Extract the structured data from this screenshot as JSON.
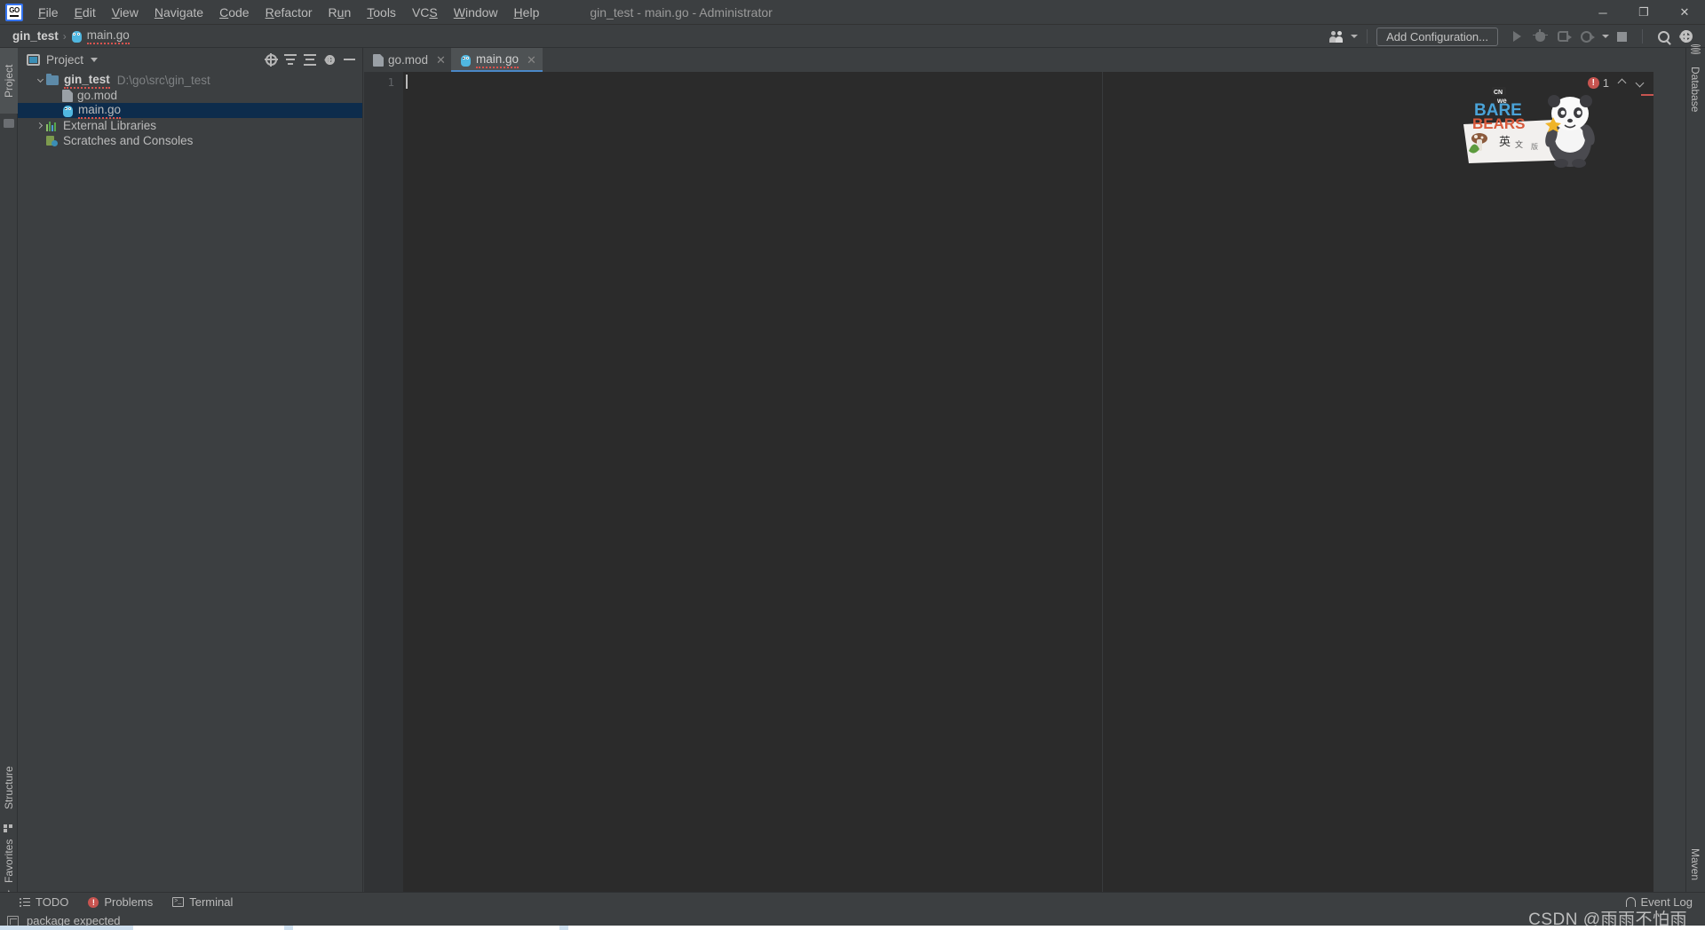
{
  "window": {
    "title": "gin_test - main.go - Administrator",
    "logo_text": "GO",
    "minimize": "─",
    "maximize": "❐",
    "close": "✕"
  },
  "menu": {
    "items": [
      {
        "label": "File",
        "mnemonic": "F"
      },
      {
        "label": "Edit",
        "mnemonic": "E"
      },
      {
        "label": "View",
        "mnemonic": "V"
      },
      {
        "label": "Navigate",
        "mnemonic": "N"
      },
      {
        "label": "Code",
        "mnemonic": "C"
      },
      {
        "label": "Refactor",
        "mnemonic": "R"
      },
      {
        "label": "Run",
        "mnemonic": "u"
      },
      {
        "label": "Tools",
        "mnemonic": "T"
      },
      {
        "label": "VCS",
        "mnemonic": "S"
      },
      {
        "label": "Window",
        "mnemonic": "W"
      },
      {
        "label": "Help",
        "mnemonic": "H"
      }
    ]
  },
  "breadcrumb": {
    "project": "gin_test",
    "separator": "›",
    "file": "main.go"
  },
  "toolbar": {
    "add_configuration": "Add Configuration...",
    "run_tooltip": "Run",
    "debug_tooltip": "Debug",
    "coverage_tooltip": "Run with Coverage",
    "profile_tooltip": "Profile",
    "stop_tooltip": "Stop",
    "search_tooltip": "Search Everywhere",
    "settings_tooltip": "Settings"
  },
  "left_strip": {
    "tabs": [
      {
        "label": "Project",
        "icon": "project-icon",
        "active": true
      },
      {
        "label": "Structure",
        "icon": "structure-icon",
        "active": false
      },
      {
        "label": "Favorites",
        "icon": "star-icon",
        "active": false
      }
    ]
  },
  "right_strip": {
    "tabs": [
      {
        "label": "Database",
        "icon": "database-icon"
      },
      {
        "label": "Maven",
        "icon": "maven-icon"
      }
    ]
  },
  "project_panel": {
    "title": "Project",
    "actions": [
      "locate-icon",
      "collapse-all-icon",
      "sort-icon",
      "settings-icon",
      "hide-icon"
    ],
    "tree": [
      {
        "label": "gin_test",
        "path": "D:\\go\\src\\gin_test",
        "icon": "folder-icon",
        "indent": 0,
        "arrow": "down",
        "selected": false,
        "bold": true
      },
      {
        "label": "go.mod",
        "path": "",
        "icon": "module-file-icon",
        "indent": 1,
        "arrow": "none",
        "selected": false,
        "bold": false
      },
      {
        "label": "main.go",
        "path": "",
        "icon": "go-file-icon",
        "indent": 1,
        "arrow": "none",
        "selected": true,
        "bold": false
      },
      {
        "label": "External Libraries",
        "path": "",
        "icon": "libraries-icon",
        "indent": 0,
        "arrow": "right",
        "selected": false,
        "bold": false
      },
      {
        "label": "Scratches and Consoles",
        "path": "",
        "icon": "scratches-icon",
        "indent": 0,
        "arrow": "none",
        "selected": false,
        "bold": false
      }
    ]
  },
  "editor": {
    "tabs": [
      {
        "label": "go.mod",
        "icon": "module-file-icon",
        "active": false,
        "close": "✕"
      },
      {
        "label": "main.go",
        "icon": "go-file-icon",
        "active": true,
        "close": "✕"
      }
    ],
    "line_numbers": [
      "1"
    ],
    "content": "",
    "inspection": {
      "error_count": "1",
      "error_glyph": "!",
      "prev": "prev-error",
      "next": "next-error"
    }
  },
  "bottom_tabs": [
    {
      "label": "TODO",
      "icon": "todo-icon"
    },
    {
      "label": "Problems",
      "icon": "problems-icon"
    },
    {
      "label": "Terminal",
      "icon": "terminal-icon"
    }
  ],
  "event_log": {
    "label": "Event Log",
    "icon": "bell-icon"
  },
  "status_bar": {
    "message": "package expected",
    "icon": "inspection-icon"
  },
  "watermark": {
    "prefix": "CSDN",
    "text": "CSDN @雨雨不怕雨"
  },
  "colors": {
    "chrome": "#3c3f41",
    "editor_bg": "#2b2b2b",
    "gutter_bg": "#313335",
    "selection": "#0d2c4c",
    "accent": "#4a88c7",
    "error": "#c75450",
    "text": "#bbbbbb",
    "muted": "#7e8183"
  }
}
